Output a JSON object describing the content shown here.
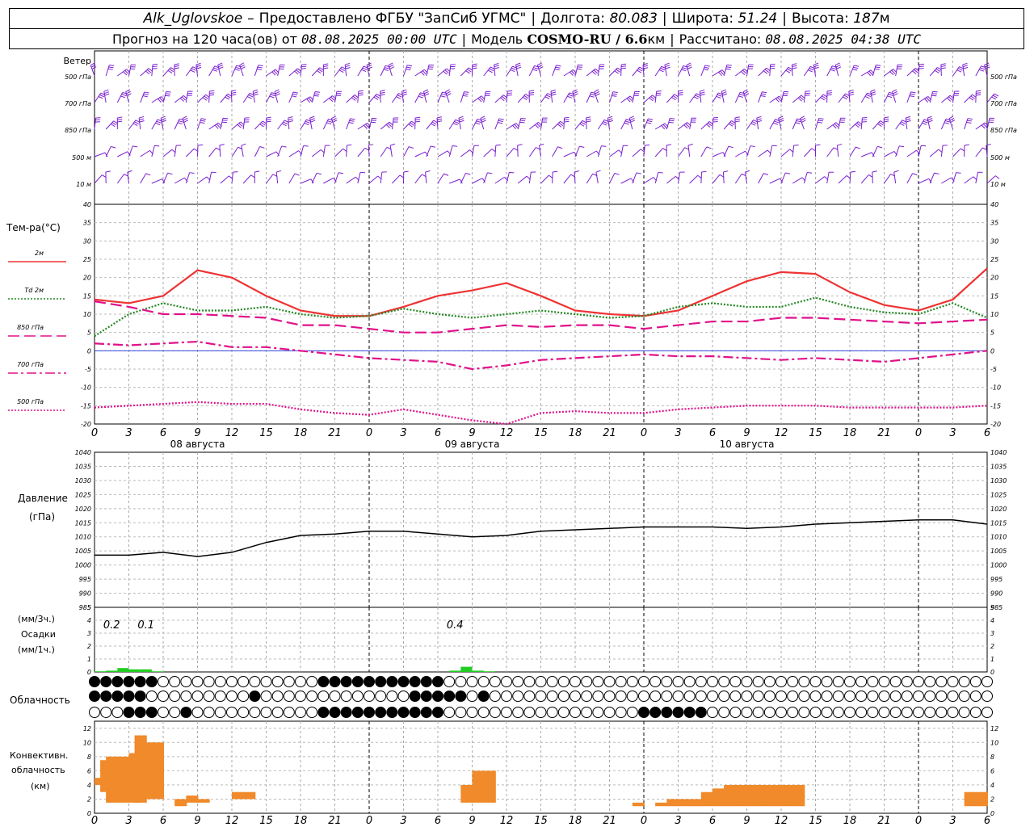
{
  "header": {
    "station": "Alk_Uglovskoe",
    "dash": "–",
    "provider": "Предоставлено ФГБУ \"ЗапСиб УГМС\"",
    "lon_label": "Долгота:",
    "lon": "80.083",
    "lat_label": "Широта:",
    "lat": "51.24",
    "alt_label": "Высота:",
    "alt": "187",
    "alt_unit": "м",
    "forecast_prefix": "Прогноз на 120 часа(ов) от",
    "forecast_start": "08.08.2025 00:00 UTC",
    "model_label": "Модель",
    "model": "COSMO-RU / 6.6",
    "model_unit": "км",
    "computed_label": "Рассчитано:",
    "computed": "08.08.2025 04:38 UTC"
  },
  "wind": {
    "title": "Ветер",
    "levels": [
      "500 гПа",
      "700 гПа",
      "850 гПа",
      "500 м",
      "10 м"
    ],
    "levels_right": [
      "500 гПа",
      "700 гПа",
      "850 гПа",
      "500 м",
      "10 м"
    ],
    "color": "#7a1fd0"
  },
  "temperature": {
    "title": "Тем-ра(°C)",
    "legend": [
      {
        "label": "2м",
        "color": "#ee3333",
        "style": "solid"
      },
      {
        "label": "Td 2м",
        "color": "#228822",
        "style": "dotted"
      },
      {
        "label": "850 гПа",
        "color": "#e0118a",
        "style": "dashed"
      },
      {
        "label": "700 гПа",
        "color": "#e0118a",
        "style": "dashdot"
      },
      {
        "label": "500 гПа",
        "color": "#e0118a",
        "style": "dotted"
      }
    ],
    "y_ticks": [
      "40",
      "35",
      "30",
      "25",
      "20",
      "15",
      "10",
      "5",
      "0",
      "-5",
      "-10",
      "-15",
      "-20"
    ]
  },
  "x_axis": {
    "hour_labels": [
      "0",
      "3",
      "6",
      "9",
      "12",
      "15",
      "18",
      "21",
      "0",
      "3",
      "6",
      "9",
      "12",
      "15",
      "18",
      "21",
      "0",
      "3",
      "6",
      "9",
      "12",
      "15",
      "18",
      "21",
      "0",
      "3",
      "6"
    ],
    "dates": [
      "08 августа",
      "09 августа",
      "10 августа"
    ]
  },
  "pressure": {
    "title": "Давление",
    "unit": "(гПа)",
    "y_ticks": [
      "1040",
      "1035",
      "1030",
      "1025",
      "1020",
      "1015",
      "1010",
      "1005",
      "1000",
      "995",
      "990",
      "985"
    ]
  },
  "precip": {
    "unit_top": "(мм/3ч.)",
    "title": "Осадки",
    "unit_bottom": "(мм/1ч.)",
    "y_ticks": [
      "5",
      "4",
      "3",
      "2",
      "1",
      "0"
    ],
    "annotations": [
      "0.2",
      "0.1",
      "0.4"
    ],
    "color": "#22cc22"
  },
  "cloud": {
    "title": "Облачность"
  },
  "convective": {
    "title_line1": "Конвективн.",
    "title_line2": "облачность",
    "unit": "(км)",
    "y_ticks": [
      "12",
      "10",
      "8",
      "6",
      "4",
      "2",
      "0"
    ],
    "color": "#f08a2a"
  },
  "chart_data": [
    {
      "type": "line",
      "title": "Тем-ра(°C)",
      "x_hours": [
        0,
        3,
        6,
        9,
        12,
        15,
        18,
        21,
        24,
        27,
        30,
        33,
        36,
        39,
        42,
        45,
        48,
        51,
        54,
        57,
        60,
        63,
        66,
        69,
        72,
        75,
        78
      ],
      "ylim": [
        -20,
        40
      ],
      "series": [
        {
          "name": "2м",
          "values": [
            14,
            13,
            15,
            22,
            20,
            15,
            11,
            9.5,
            9.5,
            12,
            15,
            16.5,
            18.5,
            15,
            11,
            10,
            9.5,
            11,
            15,
            19,
            21.5,
            21,
            16,
            12.5,
            11,
            14,
            22.5
          ]
        },
        {
          "name": "Td 2м",
          "values": [
            4,
            10,
            13,
            11,
            11,
            12,
            10,
            9,
            9.5,
            11.5,
            10,
            9,
            10,
            11,
            10,
            9,
            9.5,
            12,
            13,
            12,
            12,
            14.5,
            12,
            10.5,
            10,
            13,
            9
          ]
        },
        {
          "name": "850 гПа",
          "values": [
            13.5,
            12,
            10,
            10,
            9.5,
            9,
            7,
            7,
            6,
            5,
            5,
            6,
            7,
            6.5,
            7,
            7,
            6,
            7,
            8,
            8,
            9,
            9,
            8.5,
            8,
            7.5,
            8,
            8.5
          ]
        },
        {
          "name": "700 гПа",
          "values": [
            2,
            1.5,
            2,
            2.5,
            1,
            1,
            0,
            -1,
            -2,
            -2.5,
            -3,
            -5,
            -4,
            -2.5,
            -2,
            -1.5,
            -1,
            -1.5,
            -1.5,
            -2,
            -2.5,
            -2,
            -2.5,
            -3,
            -2,
            -1,
            0
          ]
        },
        {
          "name": "500 гПа",
          "values": [
            -15.5,
            -15,
            -14.5,
            -14,
            -14.5,
            -14.5,
            -16,
            -17,
            -17.5,
            -16,
            -17.5,
            -19,
            -20,
            -17,
            -16.5,
            -17,
            -17,
            -16,
            -15.5,
            -15,
            -15,
            -15,
            -15.5,
            -15.5,
            -15.5,
            -15.5,
            -15
          ]
        }
      ]
    },
    {
      "type": "line",
      "title": "Давление",
      "x_hours": [
        0,
        3,
        6,
        9,
        12,
        15,
        18,
        21,
        24,
        27,
        30,
        33,
        36,
        39,
        42,
        45,
        48,
        51,
        54,
        57,
        60,
        63,
        66,
        69,
        72,
        75,
        78
      ],
      "ylim": [
        985,
        1040
      ],
      "series": [
        {
          "name": "Давление",
          "values": [
            1003.5,
            1003.5,
            1004.5,
            1003,
            1004.5,
            1008,
            1010.5,
            1011,
            1012,
            1012,
            1011,
            1010,
            1010.5,
            1012,
            1012.5,
            1013,
            1013.5,
            1013.5,
            1013.5,
            1013,
            1013.5,
            1014.5,
            1015,
            1015.5,
            1016,
            1016,
            1014.5
          ]
        }
      ]
    },
    {
      "type": "bar",
      "title": "Осадки",
      "x_hours": [
        0,
        1,
        2,
        3,
        4,
        5,
        6,
        30,
        31,
        32,
        33,
        34,
        35
      ],
      "ylim": [
        0,
        5
      ],
      "values": [
        0.05,
        0.1,
        0.3,
        0.2,
        0.2,
        0.05,
        0,
        0,
        0.1,
        0.4,
        0.1,
        0.05,
        0
      ]
    },
    {
      "type": "bar",
      "title": "Конвективн. облачность",
      "ylim": [
        0,
        13
      ],
      "x_hours": [
        0,
        0.5,
        1,
        2,
        3,
        3.5,
        4,
        5,
        6,
        7,
        8,
        9,
        12,
        13,
        32,
        33,
        34,
        35,
        36,
        47,
        49,
        50,
        51,
        52,
        53,
        54,
        55,
        56,
        57,
        58,
        59,
        60,
        61,
        76,
        77
      ],
      "values": [
        [
          4,
          5
        ],
        [
          3,
          7.5
        ],
        [
          1.5,
          8
        ],
        [
          1.5,
          8
        ],
        [
          1.5,
          8.5
        ],
        [
          1.5,
          11
        ],
        [
          2,
          10
        ],
        [
          2,
          10
        ],
        [
          1,
          1
        ],
        [
          1,
          2
        ],
        [
          1.5,
          2.5
        ],
        [
          1.5,
          2
        ],
        [
          2,
          3
        ],
        [
          2,
          3
        ],
        [
          1.5,
          4
        ],
        [
          1.5,
          6
        ],
        [
          1.5,
          6
        ],
        [
          1,
          1
        ],
        [
          1,
          1
        ],
        [
          1,
          1.5
        ],
        [
          1,
          1.5
        ],
        [
          1,
          2
        ],
        [
          1,
          2
        ],
        [
          1,
          2
        ],
        [
          1,
          3
        ],
        [
          1,
          3.5
        ],
        [
          1,
          4
        ],
        [
          1,
          4
        ],
        [
          1,
          4
        ],
        [
          1,
          4
        ],
        [
          1,
          4
        ],
        [
          1,
          4
        ],
        [
          1,
          4
        ],
        [
          1,
          3
        ],
        [
          1,
          3
        ]
      ]
    }
  ]
}
